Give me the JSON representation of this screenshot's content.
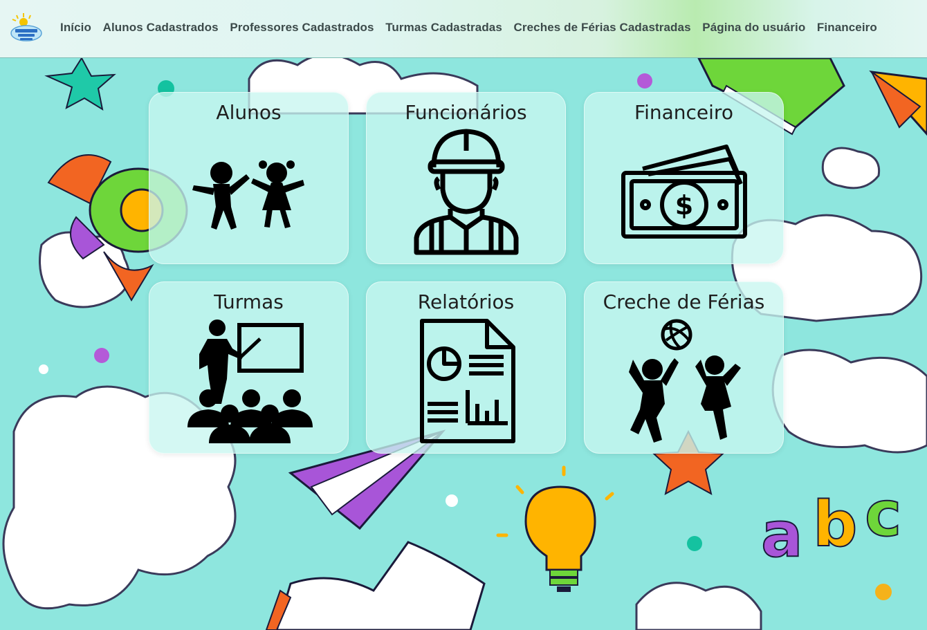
{
  "nav": {
    "logo_icon": "escola-logo-icon",
    "items": [
      {
        "label": "Início"
      },
      {
        "label": "Alunos Cadastrados"
      },
      {
        "label": "Professores Cadastrados"
      },
      {
        "label": "Turmas Cadastradas"
      },
      {
        "label": "Creches de Férias Cadastradas"
      },
      {
        "label": "Página do usuário"
      },
      {
        "label": "Financeiro"
      }
    ]
  },
  "cards": [
    {
      "title": "Alunos",
      "icon": "children-icon"
    },
    {
      "title": "Funcionários",
      "icon": "worker-icon"
    },
    {
      "title": "Financeiro",
      "icon": "money-icon"
    },
    {
      "title": "Turmas",
      "icon": "classroom-icon"
    },
    {
      "title": "Relatórios",
      "icon": "report-icon"
    },
    {
      "title": "Creche de Férias",
      "icon": "kids-playing-icon"
    }
  ],
  "colors": {
    "background": "#8ee6de",
    "card": "#c8f6f0",
    "text": "#1e1e1e",
    "nav_text": "#3c4a4a"
  }
}
